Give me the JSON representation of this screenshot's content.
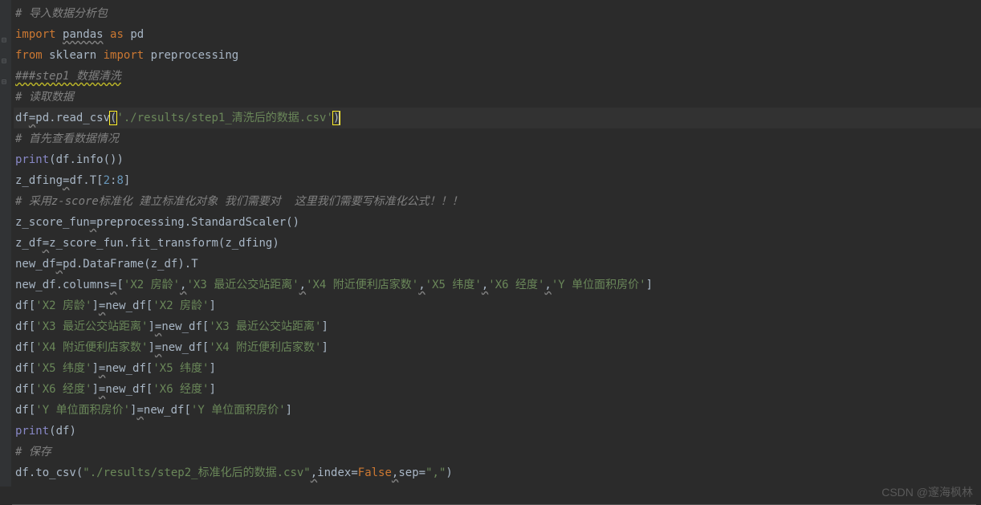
{
  "editor": {
    "lines": [
      {
        "type": "comment",
        "segments": [
          {
            "cls": "comment",
            "text": "# 导入数据分析包"
          }
        ]
      },
      {
        "fold": true,
        "segments": [
          {
            "cls": "keyword",
            "text": "import "
          },
          {
            "cls": "ident underline",
            "text": "pandas"
          },
          {
            "cls": "keyword",
            "text": " as "
          },
          {
            "cls": "ident",
            "text": "pd"
          }
        ]
      },
      {
        "fold": true,
        "segments": [
          {
            "cls": "keyword",
            "text": "from "
          },
          {
            "cls": "ident",
            "text": "sklearn"
          },
          {
            "cls": "keyword",
            "text": " import "
          },
          {
            "cls": "ident",
            "text": "preprocessing"
          }
        ]
      },
      {
        "fold": true,
        "segments": [
          {
            "cls": "comment underline-warn",
            "text": "###step1 数据清洗"
          }
        ]
      },
      {
        "segments": [
          {
            "cls": "comment",
            "text": "# 读取数据"
          }
        ]
      },
      {
        "current": true,
        "segments": [
          {
            "cls": "ident",
            "text": "df"
          },
          {
            "cls": "ident underline",
            "text": "="
          },
          {
            "cls": "ident",
            "text": "pd.read_csv"
          },
          {
            "cls": "bracket bracket-match",
            "text": "("
          },
          {
            "cls": "string",
            "text": "'./results/step1_清洗后的数据.csv'"
          },
          {
            "cls": "bracket bracket-match",
            "text": ")"
          }
        ]
      },
      {
        "segments": [
          {
            "cls": "comment",
            "text": "# 首先查看数据情况"
          }
        ]
      },
      {
        "segments": [
          {
            "cls": "builtin",
            "text": "print"
          },
          {
            "cls": "bracket",
            "text": "("
          },
          {
            "cls": "ident",
            "text": "df.info"
          },
          {
            "cls": "bracket",
            "text": "())"
          }
        ]
      },
      {
        "segments": [
          {
            "cls": "ident",
            "text": "z_dfing"
          },
          {
            "cls": "ident underline",
            "text": "="
          },
          {
            "cls": "ident",
            "text": "df.T"
          },
          {
            "cls": "bracket",
            "text": "["
          },
          {
            "cls": "number",
            "text": "2"
          },
          {
            "cls": "ident",
            "text": ":"
          },
          {
            "cls": "number",
            "text": "8"
          },
          {
            "cls": "bracket",
            "text": "]"
          }
        ]
      },
      {
        "segments": [
          {
            "cls": "comment",
            "text": "# 采用z-score标准化 建立标准化对象 我们需要对  这里我们需要写标准化公式！！！"
          }
        ]
      },
      {
        "segments": [
          {
            "cls": "ident",
            "text": "z_score_fun"
          },
          {
            "cls": "ident underline",
            "text": "="
          },
          {
            "cls": "ident",
            "text": "preprocessing.StandardScaler"
          },
          {
            "cls": "bracket",
            "text": "()"
          }
        ]
      },
      {
        "segments": [
          {
            "cls": "ident",
            "text": "z_df"
          },
          {
            "cls": "ident underline",
            "text": "="
          },
          {
            "cls": "ident",
            "text": "z_score_fun.fit_transform"
          },
          {
            "cls": "bracket",
            "text": "("
          },
          {
            "cls": "ident",
            "text": "z_dfing"
          },
          {
            "cls": "bracket",
            "text": ")"
          }
        ]
      },
      {
        "segments": [
          {
            "cls": "ident",
            "text": "new_df"
          },
          {
            "cls": "ident underline",
            "text": "="
          },
          {
            "cls": "ident",
            "text": "pd.DataFrame"
          },
          {
            "cls": "bracket",
            "text": "("
          },
          {
            "cls": "ident",
            "text": "z_df"
          },
          {
            "cls": "bracket",
            "text": ")"
          },
          {
            "cls": "ident",
            "text": ".T"
          }
        ]
      },
      {
        "segments": [
          {
            "cls": "ident",
            "text": "new_df.columns"
          },
          {
            "cls": "ident underline",
            "text": "="
          },
          {
            "cls": "bracket",
            "text": "["
          },
          {
            "cls": "string",
            "text": "'X2 房龄'"
          },
          {
            "cls": "ident underline",
            "text": ","
          },
          {
            "cls": "string",
            "text": "'X3 最近公交站距离'"
          },
          {
            "cls": "ident underline",
            "text": ","
          },
          {
            "cls": "string",
            "text": "'X4 附近便利店家数'"
          },
          {
            "cls": "ident underline",
            "text": ","
          },
          {
            "cls": "string",
            "text": "'X5 纬度'"
          },
          {
            "cls": "ident underline",
            "text": ","
          },
          {
            "cls": "string",
            "text": "'X6 经度'"
          },
          {
            "cls": "ident underline",
            "text": ","
          },
          {
            "cls": "string",
            "text": "'Y 单位面积房价'"
          },
          {
            "cls": "bracket",
            "text": "]"
          }
        ]
      },
      {
        "segments": [
          {
            "cls": "ident",
            "text": "df"
          },
          {
            "cls": "bracket",
            "text": "["
          },
          {
            "cls": "string",
            "text": "'X2 房龄'"
          },
          {
            "cls": "bracket",
            "text": "]"
          },
          {
            "cls": "ident underline",
            "text": "="
          },
          {
            "cls": "ident",
            "text": "new_df"
          },
          {
            "cls": "bracket",
            "text": "["
          },
          {
            "cls": "string",
            "text": "'X2 房龄'"
          },
          {
            "cls": "bracket",
            "text": "]"
          }
        ]
      },
      {
        "segments": [
          {
            "cls": "ident",
            "text": "df"
          },
          {
            "cls": "bracket",
            "text": "["
          },
          {
            "cls": "string",
            "text": "'X3 最近公交站距离'"
          },
          {
            "cls": "bracket",
            "text": "]"
          },
          {
            "cls": "ident underline",
            "text": "="
          },
          {
            "cls": "ident",
            "text": "new_df"
          },
          {
            "cls": "bracket",
            "text": "["
          },
          {
            "cls": "string",
            "text": "'X3 最近公交站距离'"
          },
          {
            "cls": "bracket",
            "text": "]"
          }
        ]
      },
      {
        "segments": [
          {
            "cls": "ident",
            "text": "df"
          },
          {
            "cls": "bracket",
            "text": "["
          },
          {
            "cls": "string",
            "text": "'X4 附近便利店家数'"
          },
          {
            "cls": "bracket",
            "text": "]"
          },
          {
            "cls": "ident underline",
            "text": "="
          },
          {
            "cls": "ident",
            "text": "new_df"
          },
          {
            "cls": "bracket",
            "text": "["
          },
          {
            "cls": "string",
            "text": "'X4 附近便利店家数'"
          },
          {
            "cls": "bracket",
            "text": "]"
          }
        ]
      },
      {
        "segments": [
          {
            "cls": "ident",
            "text": "df"
          },
          {
            "cls": "bracket",
            "text": "["
          },
          {
            "cls": "string",
            "text": "'X5 纬度'"
          },
          {
            "cls": "bracket",
            "text": "]"
          },
          {
            "cls": "ident underline",
            "text": "="
          },
          {
            "cls": "ident",
            "text": "new_df"
          },
          {
            "cls": "bracket",
            "text": "["
          },
          {
            "cls": "string",
            "text": "'X5 纬度'"
          },
          {
            "cls": "bracket",
            "text": "]"
          }
        ]
      },
      {
        "segments": [
          {
            "cls": "ident",
            "text": "df"
          },
          {
            "cls": "bracket",
            "text": "["
          },
          {
            "cls": "string",
            "text": "'X6 经度'"
          },
          {
            "cls": "bracket",
            "text": "]"
          },
          {
            "cls": "ident underline",
            "text": "="
          },
          {
            "cls": "ident",
            "text": "new_df"
          },
          {
            "cls": "bracket",
            "text": "["
          },
          {
            "cls": "string",
            "text": "'X6 经度'"
          },
          {
            "cls": "bracket",
            "text": "]"
          }
        ]
      },
      {
        "segments": [
          {
            "cls": "ident",
            "text": "df"
          },
          {
            "cls": "bracket",
            "text": "["
          },
          {
            "cls": "string",
            "text": "'Y 单位面积房价'"
          },
          {
            "cls": "bracket",
            "text": "]"
          },
          {
            "cls": "ident underline",
            "text": "="
          },
          {
            "cls": "ident",
            "text": "new_df"
          },
          {
            "cls": "bracket",
            "text": "["
          },
          {
            "cls": "string",
            "text": "'Y 单位面积房价'"
          },
          {
            "cls": "bracket",
            "text": "]"
          }
        ]
      },
      {
        "segments": [
          {
            "cls": "builtin",
            "text": "print"
          },
          {
            "cls": "bracket",
            "text": "("
          },
          {
            "cls": "ident",
            "text": "df"
          },
          {
            "cls": "bracket",
            "text": ")"
          }
        ]
      },
      {
        "segments": [
          {
            "cls": "comment",
            "text": "# 保存"
          }
        ]
      },
      {
        "segments": [
          {
            "cls": "ident",
            "text": "df.to_csv"
          },
          {
            "cls": "bracket",
            "text": "("
          },
          {
            "cls": "string",
            "text": "\"./results/step2_标准化后的数据.csv\""
          },
          {
            "cls": "ident underline",
            "text": ","
          },
          {
            "cls": "ident",
            "text": "index"
          },
          {
            "cls": "ident",
            "text": "="
          },
          {
            "cls": "keyword",
            "text": "False"
          },
          {
            "cls": "ident underline",
            "text": ","
          },
          {
            "cls": "ident",
            "text": "sep"
          },
          {
            "cls": "ident",
            "text": "="
          },
          {
            "cls": "string",
            "text": "\",\""
          },
          {
            "cls": "bracket",
            "text": ")"
          }
        ]
      }
    ]
  },
  "watermark": "CSDN @邃海枫林"
}
